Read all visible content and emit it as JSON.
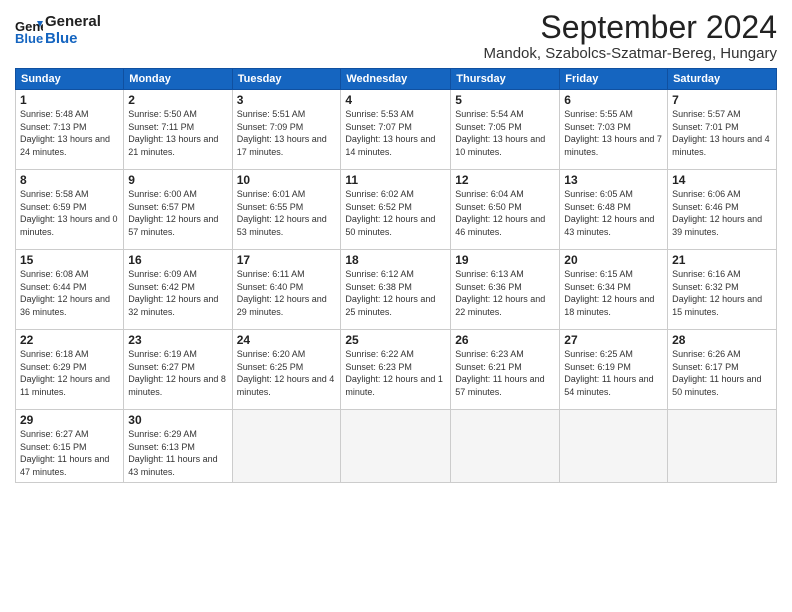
{
  "header": {
    "logo_line1": "General",
    "logo_line2": "Blue",
    "month": "September 2024",
    "location": "Mandok, Szabolcs-Szatmar-Bereg, Hungary"
  },
  "weekdays": [
    "Sunday",
    "Monday",
    "Tuesday",
    "Wednesday",
    "Thursday",
    "Friday",
    "Saturday"
  ],
  "weeks": [
    [
      {
        "day": "1",
        "sunrise": "Sunrise: 5:48 AM",
        "sunset": "Sunset: 7:13 PM",
        "daylight": "Daylight: 13 hours and 24 minutes."
      },
      {
        "day": "2",
        "sunrise": "Sunrise: 5:50 AM",
        "sunset": "Sunset: 7:11 PM",
        "daylight": "Daylight: 13 hours and 21 minutes."
      },
      {
        "day": "3",
        "sunrise": "Sunrise: 5:51 AM",
        "sunset": "Sunset: 7:09 PM",
        "daylight": "Daylight: 13 hours and 17 minutes."
      },
      {
        "day": "4",
        "sunrise": "Sunrise: 5:53 AM",
        "sunset": "Sunset: 7:07 PM",
        "daylight": "Daylight: 13 hours and 14 minutes."
      },
      {
        "day": "5",
        "sunrise": "Sunrise: 5:54 AM",
        "sunset": "Sunset: 7:05 PM",
        "daylight": "Daylight: 13 hours and 10 minutes."
      },
      {
        "day": "6",
        "sunrise": "Sunrise: 5:55 AM",
        "sunset": "Sunset: 7:03 PM",
        "daylight": "Daylight: 13 hours and 7 minutes."
      },
      {
        "day": "7",
        "sunrise": "Sunrise: 5:57 AM",
        "sunset": "Sunset: 7:01 PM",
        "daylight": "Daylight: 13 hours and 4 minutes."
      }
    ],
    [
      {
        "day": "8",
        "sunrise": "Sunrise: 5:58 AM",
        "sunset": "Sunset: 6:59 PM",
        "daylight": "Daylight: 13 hours and 0 minutes."
      },
      {
        "day": "9",
        "sunrise": "Sunrise: 6:00 AM",
        "sunset": "Sunset: 6:57 PM",
        "daylight": "Daylight: 12 hours and 57 minutes."
      },
      {
        "day": "10",
        "sunrise": "Sunrise: 6:01 AM",
        "sunset": "Sunset: 6:55 PM",
        "daylight": "Daylight: 12 hours and 53 minutes."
      },
      {
        "day": "11",
        "sunrise": "Sunrise: 6:02 AM",
        "sunset": "Sunset: 6:52 PM",
        "daylight": "Daylight: 12 hours and 50 minutes."
      },
      {
        "day": "12",
        "sunrise": "Sunrise: 6:04 AM",
        "sunset": "Sunset: 6:50 PM",
        "daylight": "Daylight: 12 hours and 46 minutes."
      },
      {
        "day": "13",
        "sunrise": "Sunrise: 6:05 AM",
        "sunset": "Sunset: 6:48 PM",
        "daylight": "Daylight: 12 hours and 43 minutes."
      },
      {
        "day": "14",
        "sunrise": "Sunrise: 6:06 AM",
        "sunset": "Sunset: 6:46 PM",
        "daylight": "Daylight: 12 hours and 39 minutes."
      }
    ],
    [
      {
        "day": "15",
        "sunrise": "Sunrise: 6:08 AM",
        "sunset": "Sunset: 6:44 PM",
        "daylight": "Daylight: 12 hours and 36 minutes."
      },
      {
        "day": "16",
        "sunrise": "Sunrise: 6:09 AM",
        "sunset": "Sunset: 6:42 PM",
        "daylight": "Daylight: 12 hours and 32 minutes."
      },
      {
        "day": "17",
        "sunrise": "Sunrise: 6:11 AM",
        "sunset": "Sunset: 6:40 PM",
        "daylight": "Daylight: 12 hours and 29 minutes."
      },
      {
        "day": "18",
        "sunrise": "Sunrise: 6:12 AM",
        "sunset": "Sunset: 6:38 PM",
        "daylight": "Daylight: 12 hours and 25 minutes."
      },
      {
        "day": "19",
        "sunrise": "Sunrise: 6:13 AM",
        "sunset": "Sunset: 6:36 PM",
        "daylight": "Daylight: 12 hours and 22 minutes."
      },
      {
        "day": "20",
        "sunrise": "Sunrise: 6:15 AM",
        "sunset": "Sunset: 6:34 PM",
        "daylight": "Daylight: 12 hours and 18 minutes."
      },
      {
        "day": "21",
        "sunrise": "Sunrise: 6:16 AM",
        "sunset": "Sunset: 6:32 PM",
        "daylight": "Daylight: 12 hours and 15 minutes."
      }
    ],
    [
      {
        "day": "22",
        "sunrise": "Sunrise: 6:18 AM",
        "sunset": "Sunset: 6:29 PM",
        "daylight": "Daylight: 12 hours and 11 minutes."
      },
      {
        "day": "23",
        "sunrise": "Sunrise: 6:19 AM",
        "sunset": "Sunset: 6:27 PM",
        "daylight": "Daylight: 12 hours and 8 minutes."
      },
      {
        "day": "24",
        "sunrise": "Sunrise: 6:20 AM",
        "sunset": "Sunset: 6:25 PM",
        "daylight": "Daylight: 12 hours and 4 minutes."
      },
      {
        "day": "25",
        "sunrise": "Sunrise: 6:22 AM",
        "sunset": "Sunset: 6:23 PM",
        "daylight": "Daylight: 12 hours and 1 minute."
      },
      {
        "day": "26",
        "sunrise": "Sunrise: 6:23 AM",
        "sunset": "Sunset: 6:21 PM",
        "daylight": "Daylight: 11 hours and 57 minutes."
      },
      {
        "day": "27",
        "sunrise": "Sunrise: 6:25 AM",
        "sunset": "Sunset: 6:19 PM",
        "daylight": "Daylight: 11 hours and 54 minutes."
      },
      {
        "day": "28",
        "sunrise": "Sunrise: 6:26 AM",
        "sunset": "Sunset: 6:17 PM",
        "daylight": "Daylight: 11 hours and 50 minutes."
      }
    ],
    [
      {
        "day": "29",
        "sunrise": "Sunrise: 6:27 AM",
        "sunset": "Sunset: 6:15 PM",
        "daylight": "Daylight: 11 hours and 47 minutes."
      },
      {
        "day": "30",
        "sunrise": "Sunrise: 6:29 AM",
        "sunset": "Sunset: 6:13 PM",
        "daylight": "Daylight: 11 hours and 43 minutes."
      },
      null,
      null,
      null,
      null,
      null
    ]
  ]
}
